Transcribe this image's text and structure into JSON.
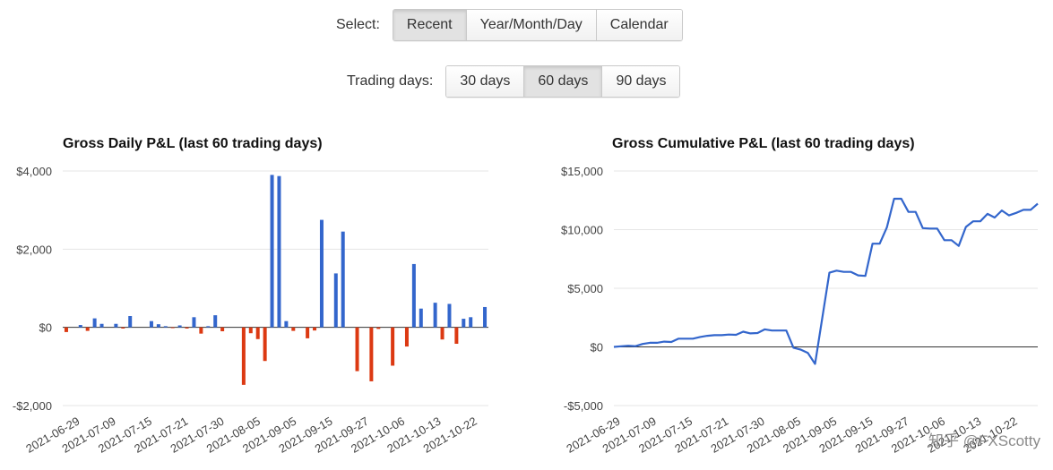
{
  "controls": {
    "select_label": "Select:",
    "select_options": [
      "Recent",
      "Year/Month/Day",
      "Calendar"
    ],
    "select_active": 0,
    "days_label": "Trading days:",
    "days_options": [
      "30 days",
      "60 days",
      "90 days"
    ],
    "days_active": 1
  },
  "chart_data": [
    {
      "type": "bar",
      "title": "Gross Daily P&L (last 60 trading days)",
      "yticks": [
        "$4,000",
        "$2,000",
        "$0",
        "-$2,000"
      ],
      "ylim": [
        -2000,
        4000
      ],
      "xtick_labels": [
        "2021-06-29",
        "2021-07-09",
        "2021-07-15",
        "2021-07-21",
        "2021-07-30",
        "2021-08-05",
        "2021-09-05",
        "2021-09-15",
        "2021-09-27",
        "2021-10-06",
        "2021-10-13",
        "2021-10-22"
      ],
      "grid": true,
      "positive_color": "#3366cc",
      "negative_color": "#dc3912",
      "values": [
        -120,
        0,
        60,
        -90,
        230,
        90,
        0,
        90,
        -30,
        290,
        0,
        0,
        160,
        80,
        30,
        -20,
        50,
        -30,
        260,
        -160,
        30,
        310,
        -100,
        0,
        0,
        -1470,
        -150,
        -300,
        -860,
        3900,
        3870,
        160,
        -90,
        0,
        -280,
        -80,
        2750,
        0,
        1380,
        2450,
        0,
        -1120,
        0,
        -1380,
        -40,
        0,
        -980,
        0,
        -490,
        1620,
        480,
        0,
        630,
        -310,
        600,
        -420,
        220,
        260,
        0,
        520
      ]
    },
    {
      "type": "line",
      "title": "Gross Cumulative P&L (last 60 trading days)",
      "yticks": [
        "$15,000",
        "$10,000",
        "$5,000",
        "$0",
        "-$5,000"
      ],
      "ylim": [
        -5000,
        15000
      ],
      "xtick_labels": [
        "2021-06-29",
        "2021-07-09",
        "2021-07-15",
        "2021-07-21",
        "2021-07-30",
        "2021-08-05",
        "2021-09-05",
        "2021-09-15",
        "2021-09-27",
        "2021-10-06",
        "2021-10-13",
        "2021-10-22"
      ],
      "grid": true,
      "line_color": "#3366cc",
      "values": [
        0,
        50,
        100,
        60,
        250,
        350,
        350,
        450,
        420,
        700,
        700,
        700,
        850,
        950,
        1000,
        1000,
        1050,
        1030,
        1300,
        1150,
        1180,
        1500,
        1400,
        1400,
        1400,
        -70,
        -230,
        -520,
        -1450,
        2450,
        6330,
        6500,
        6400,
        6400,
        6100,
        6050,
        8800,
        8800,
        10180,
        12630,
        12630,
        11510,
        11510,
        10130,
        10090,
        10090,
        9100,
        9100,
        8610,
        10230,
        10710,
        10710,
        11340,
        11030,
        11630,
        11210,
        11430,
        11690,
        11690,
        12210
      ]
    }
  ],
  "watermark": "知乎 @FXScotty"
}
